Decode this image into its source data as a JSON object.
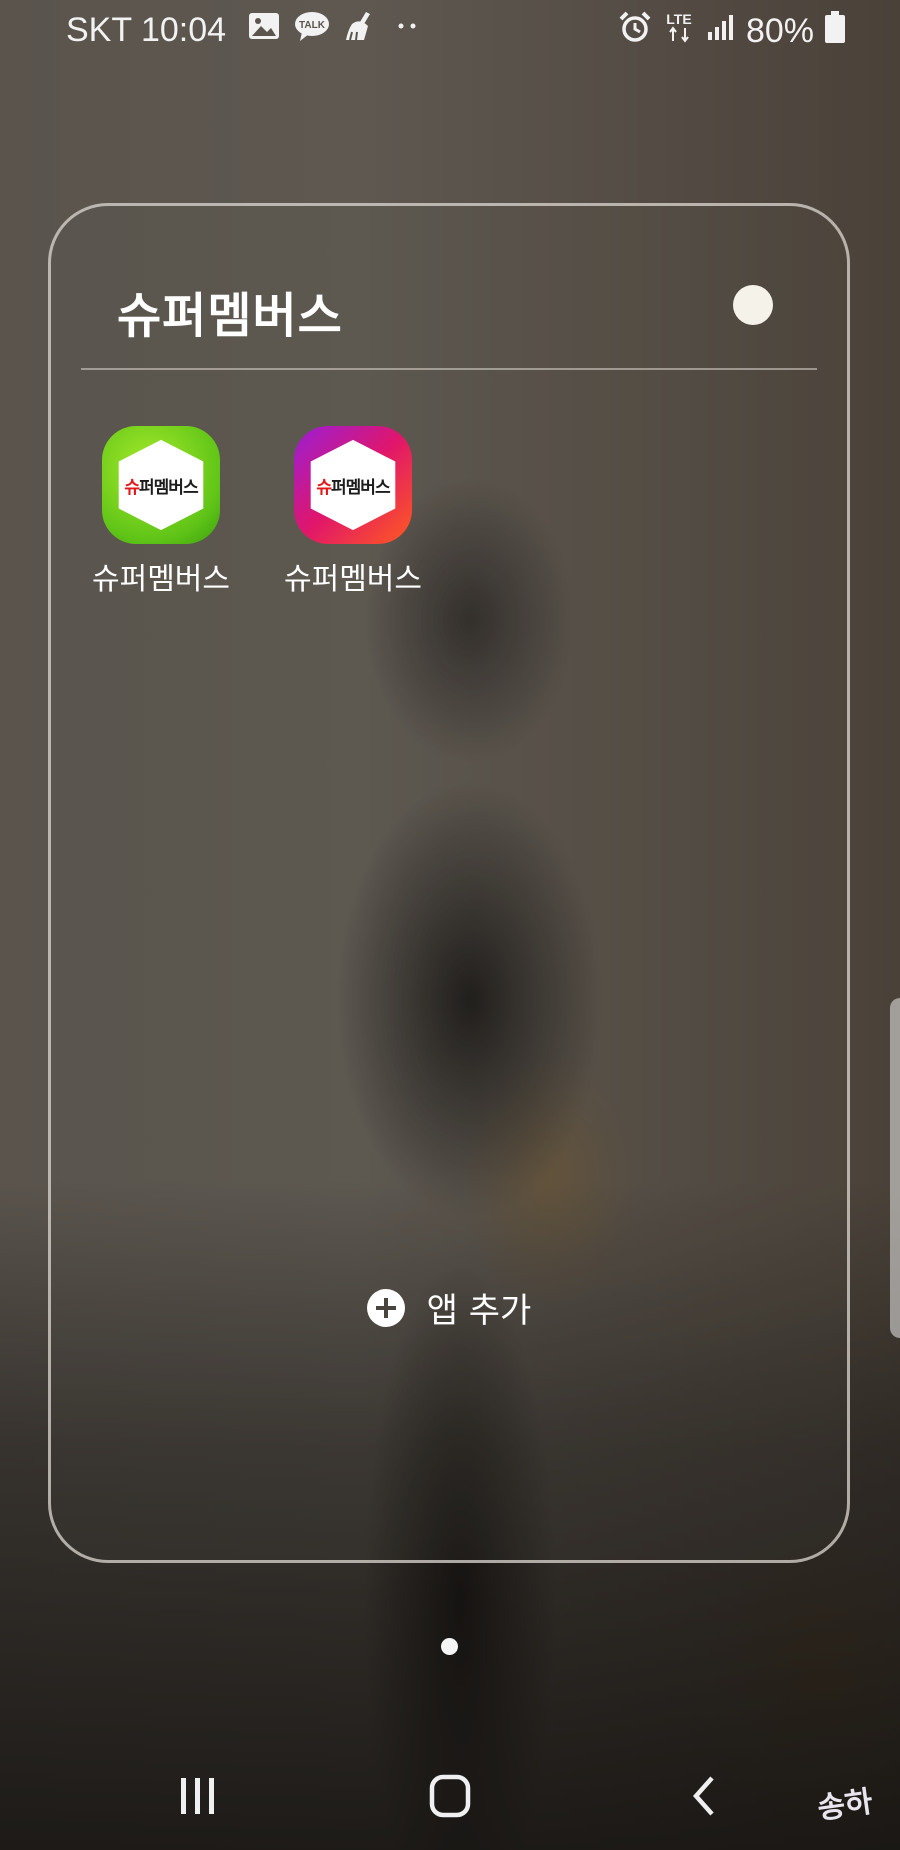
{
  "status_bar": {
    "carrier_time": "SKT 10:04",
    "network": "LTE",
    "battery": "80%",
    "left_icons": [
      "image-icon",
      "kakaotalk-icon",
      "cleaner-icon",
      "more-dots-icon"
    ],
    "right_icons": [
      "alarm-icon",
      "lte-icon",
      "signal-icon",
      "battery-icon"
    ],
    "talk_badge": "TALK"
  },
  "folder": {
    "title": "슈퍼멤버스",
    "color_dot": "#f5f2ea",
    "apps": [
      {
        "label": "슈퍼멤버스",
        "icon_text": "슈퍼멤버스",
        "icon_style": "green-hexagon",
        "accent": "#5fc417"
      },
      {
        "label": "슈퍼멤버스",
        "icon_text": "슈퍼멤버스",
        "icon_style": "gradient-hexagon",
        "accent": "#e0166a"
      }
    ],
    "add_apps_label": "앱 추가"
  },
  "page_indicator": {
    "current": 1,
    "total": 1
  },
  "navigation": {
    "buttons": [
      "recents-icon",
      "home-icon",
      "back-icon"
    ]
  },
  "watermark": "송하"
}
